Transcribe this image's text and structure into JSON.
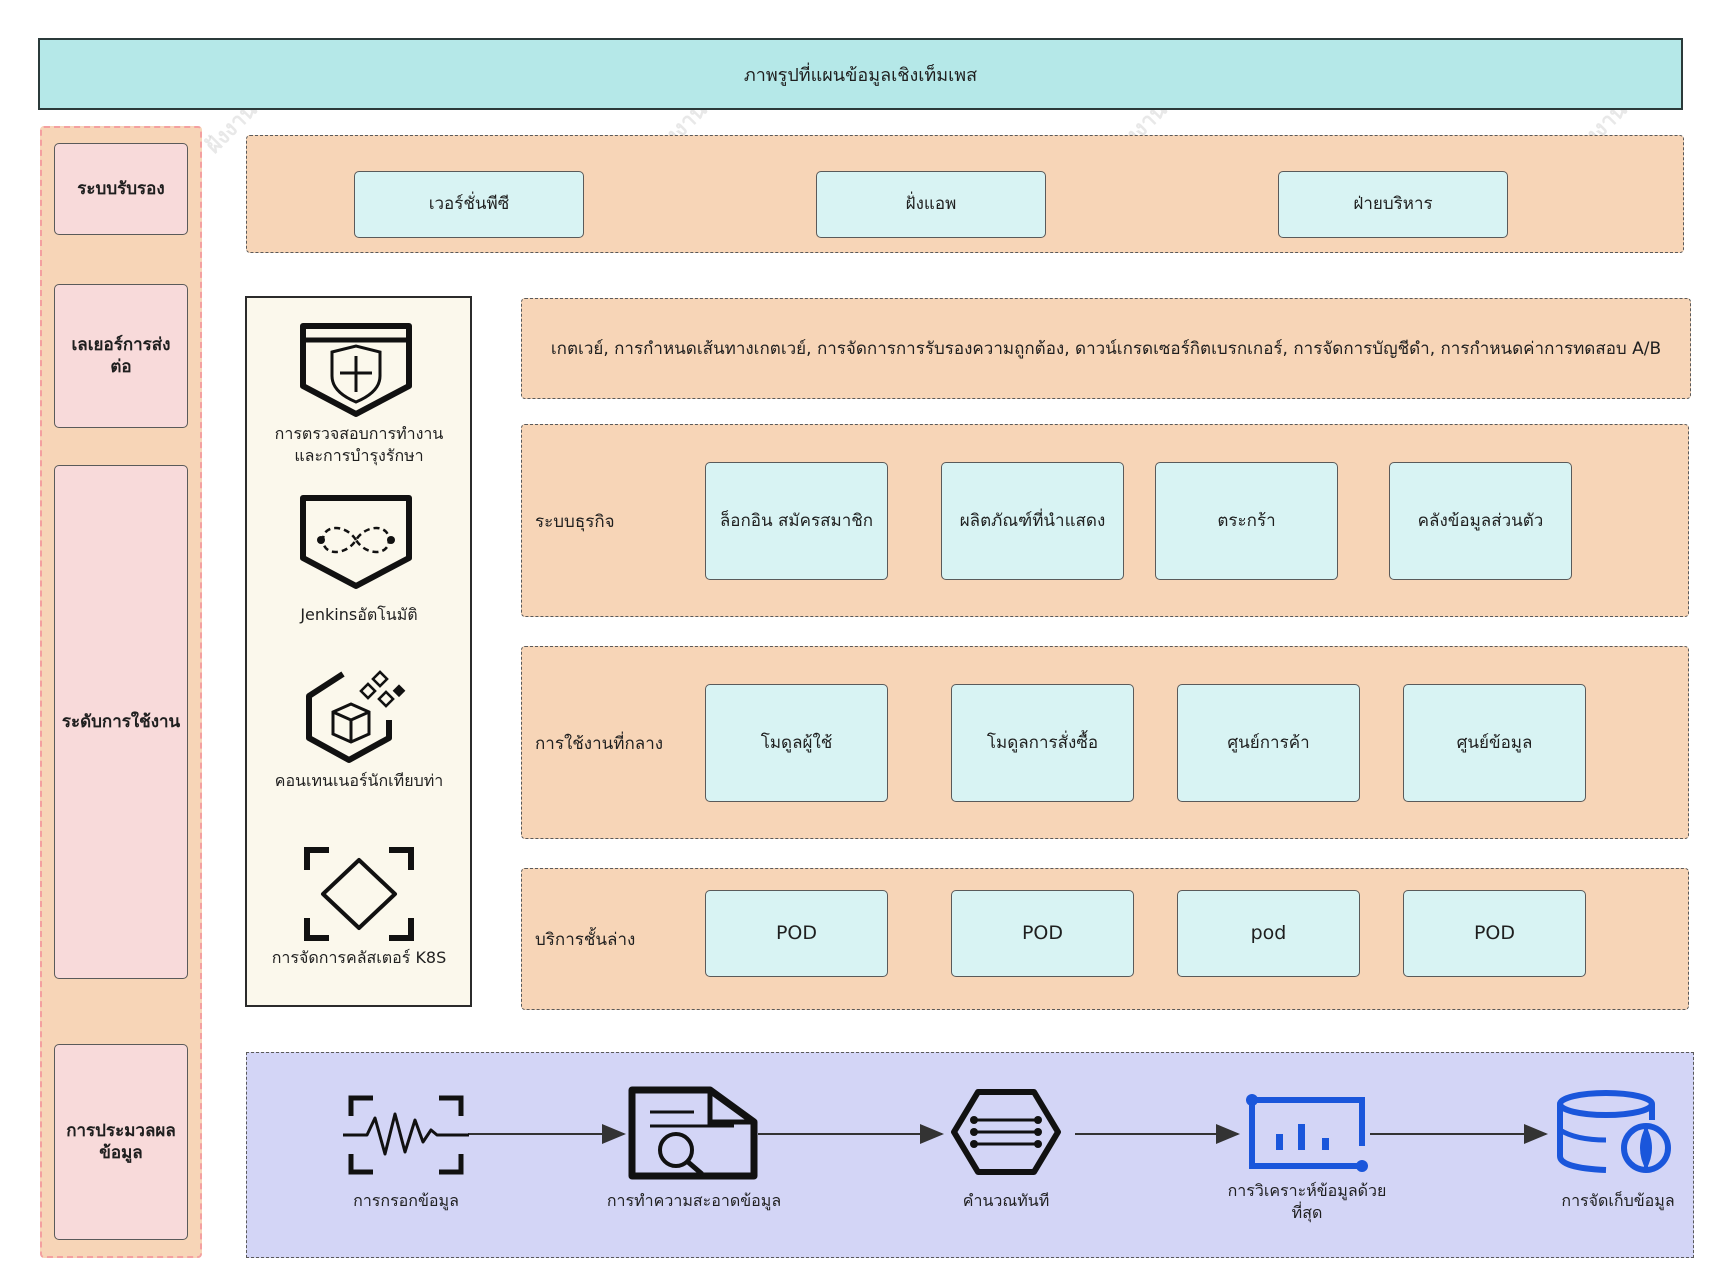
{
  "header": {
    "title": "ภาพรูปที่แผนข้อมูลเชิงเท็มเพส"
  },
  "layers": {
    "support": "ระบบรับรอง",
    "transport": "เลเยอร์การส่งต่อ",
    "application": "ระดับการใช้งาน",
    "data_processing": "การประมวลผลข้อมูล"
  },
  "clients": [
    "เวอร์ชั่นพีซี",
    "ฝั่งแอพ",
    "ฝ่ายบริหาร"
  ],
  "gateway": {
    "text": "เกตเวย์, การกำหนดเส้นทางเกตเวย์, การจัดการการรับรองความถูกต้อง, ดาวน์เกรดเซอร์กิตเบรกเกอร์, การจัดการบัญชีดำ, การกำหนดค่าการทดสอบ A/B"
  },
  "business": {
    "label": "ระบบธุรกิจ",
    "items": [
      "ล็อกอิน สมัครสมาชิก",
      "ผลิตภัณฑ์ที่นำแสดง",
      "ตระกร้า",
      "คลังข้อมูลส่วนตัว"
    ]
  },
  "middle": {
    "label": "การใช้งานที่กลาง",
    "items": [
      "โมดูลผู้ใช้",
      "โมดูลการสั่งซื้อ",
      "ศูนย์การค้า",
      "ศูนย์ข้อมูล"
    ]
  },
  "base": {
    "label": "บริการชั้นล่าง",
    "items": [
      "POD",
      "POD",
      "pod",
      "POD"
    ]
  },
  "ops": [
    {
      "label": "การตรวจสอบการทำงานและการบำรุงรักษา",
      "icon": "shield-plus-icon"
    },
    {
      "label": "Jenkinsอัตโนมัติ",
      "icon": "infinity-icon"
    },
    {
      "label": "คอนเทนเนอร์นักเทียบท่า",
      "icon": "container-icon"
    },
    {
      "label": "การจัดการคลัสเตอร์ K8S",
      "icon": "diamond-frame-icon"
    }
  ],
  "flow": [
    {
      "label": "การกรอกข้อมูล",
      "icon": "waveform-icon"
    },
    {
      "label": "การทำความสะอาดข้อมูล",
      "icon": "document-search-icon"
    },
    {
      "label": "คำนวณทันที",
      "icon": "hexagon-flow-icon"
    },
    {
      "label": "การวิเคราะห์ข้อมูลด้วยที่สุด",
      "icon": "bar-chart-icon"
    },
    {
      "label": "การจัดเก็บข้อมูล",
      "icon": "database-icon"
    }
  ],
  "colors": {
    "title_bg": "#b5e8e8",
    "orange": "#f7d5b7",
    "cyan": "#d8f3f3",
    "pink": "#f8dada",
    "purple": "#d3d5f6",
    "icon_blue": "#1a56db"
  }
}
